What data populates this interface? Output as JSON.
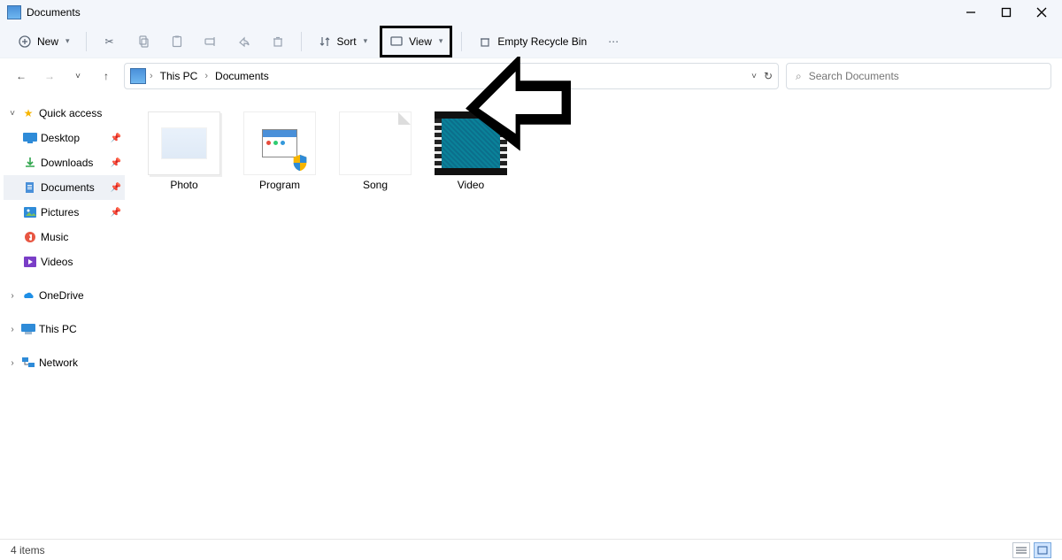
{
  "window": {
    "title": "Documents"
  },
  "toolbar": {
    "new_label": "New",
    "sort_label": "Sort",
    "view_label": "View",
    "empty_recycle_label": "Empty Recycle Bin"
  },
  "breadcrumbs": {
    "root": "This PC",
    "current": "Documents"
  },
  "search": {
    "placeholder": "Search Documents"
  },
  "sidebar": {
    "quick_access": "Quick access",
    "items": [
      {
        "label": "Desktop"
      },
      {
        "label": "Downloads"
      },
      {
        "label": "Documents"
      },
      {
        "label": "Pictures"
      },
      {
        "label": "Music"
      },
      {
        "label": "Videos"
      }
    ],
    "onedrive": "OneDrive",
    "thispc": "This PC",
    "network": "Network"
  },
  "files": [
    {
      "label": "Photo",
      "kind": "photo"
    },
    {
      "label": "Program",
      "kind": "program"
    },
    {
      "label": "Song",
      "kind": "song"
    },
    {
      "label": "Video",
      "kind": "video"
    }
  ],
  "status": {
    "count_text": "4 items"
  }
}
